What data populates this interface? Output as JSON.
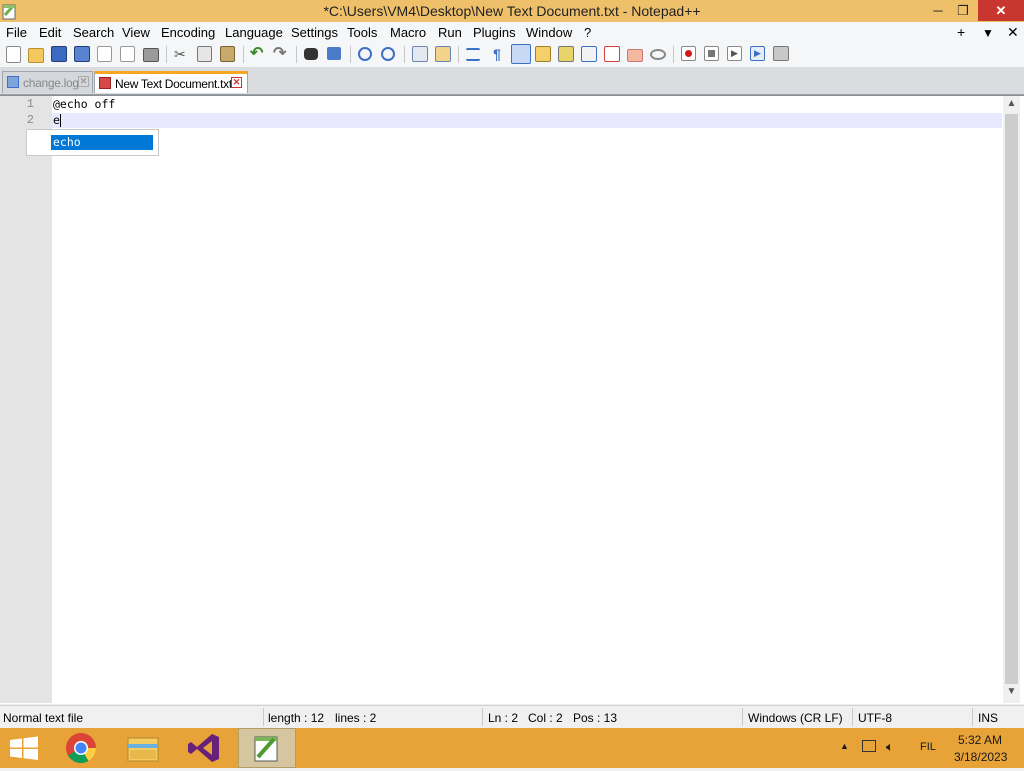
{
  "window": {
    "title": "*C:\\Users\\VM4\\Desktop\\New Text Document.txt - Notepad++",
    "minimize_glyph": "─",
    "maximize_glyph": "❐",
    "close_glyph": "✕"
  },
  "menu": {
    "items": [
      "File",
      "Edit",
      "Search",
      "View",
      "Encoding",
      "Language",
      "Settings",
      "Tools",
      "Macro",
      "Run",
      "Plugins",
      "Window",
      "?"
    ],
    "right": [
      "+",
      "▼",
      "✕"
    ]
  },
  "toolbar": {
    "icons": [
      "new-file-icon",
      "open-file-icon",
      "save-icon",
      "save-all-icon",
      "close-icon",
      "close-all-icon",
      "print-icon",
      "cut-icon",
      "copy-icon",
      "paste-icon",
      "undo-icon",
      "redo-icon",
      "find-icon",
      "replace-icon",
      "zoom-in-icon",
      "zoom-out-icon",
      "sync-vertical-icon",
      "sync-horizontal-icon",
      "word-wrap-icon",
      "show-all-chars-icon",
      "indent-guide-icon",
      "udl-icon",
      "doc-map-icon",
      "function-list-icon",
      "folder-workspace-icon",
      "monitoring-icon",
      "record-macro-icon",
      "stop-macro-icon",
      "play-macro-icon",
      "run-macro-multiple-icon",
      "save-macro-icon"
    ]
  },
  "tabs": [
    {
      "label": "change.log",
      "close": "✕",
      "active": false
    },
    {
      "label": "New Text Document.txt",
      "close": "✕",
      "active": true
    }
  ],
  "editor": {
    "lines": [
      {
        "num": "1",
        "text": "@echo off"
      },
      {
        "num": "2",
        "text": "e"
      }
    ],
    "autocomplete": [
      "echo"
    ]
  },
  "scrollbar": {
    "up": "▲",
    "down": "▼"
  },
  "status": {
    "file_type": "Normal text file",
    "length": "length : 12",
    "lines": "lines : 2",
    "ln": "Ln : 2",
    "col": "Col : 2",
    "pos": "Pos : 13",
    "eol": "Windows (CR LF)",
    "encoding": "UTF-8",
    "mode": "INS"
  },
  "taskbar": {
    "apps": [
      "windows-start-icon",
      "chrome-icon",
      "file-explorer-icon",
      "visual-studio-icon",
      "notepad-plus-plus-icon"
    ],
    "tray": {
      "arrow": "▲",
      "language": "FIL",
      "time": "5:32 AM",
      "date": "3/18/2023"
    }
  }
}
